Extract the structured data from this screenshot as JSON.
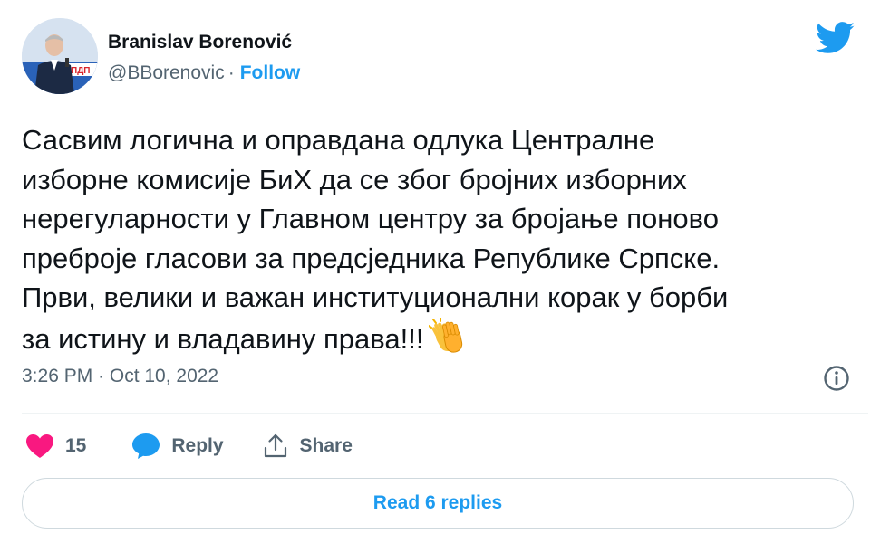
{
  "author": {
    "name": "Branislav Borenović",
    "handle": "@BBorenovic",
    "separator": "·",
    "follow_label": "Follow"
  },
  "tweet": {
    "text": "Сасвим логична и оправдана одлука Централне\nизборне комисије БиХ да се због бројних изборних\nнерегуларности у Главном центру за бројање поново\nпреброје гласови за предсједника Републике Српске.\nПрви, велики и важан институционални корак у борби\nза истину и владавину права!!!",
    "emoji": "clapping-hands",
    "timestamp": "3:26 PM · Oct 10, 2022"
  },
  "actions": {
    "like_count": "15",
    "reply_label": "Reply",
    "share_label": "Share"
  },
  "footer": {
    "read_replies_label": "Read 6 replies"
  },
  "colors": {
    "accent": "#1d9bf0",
    "like": "#f91880",
    "text_primary": "#0f1419",
    "text_secondary": "#536471",
    "border": "#cfd9de"
  },
  "icons": {
    "brand": "twitter-bird-icon",
    "info": "info-icon",
    "like": "heart-icon",
    "reply": "speech-bubble-icon",
    "share": "share-icon"
  }
}
